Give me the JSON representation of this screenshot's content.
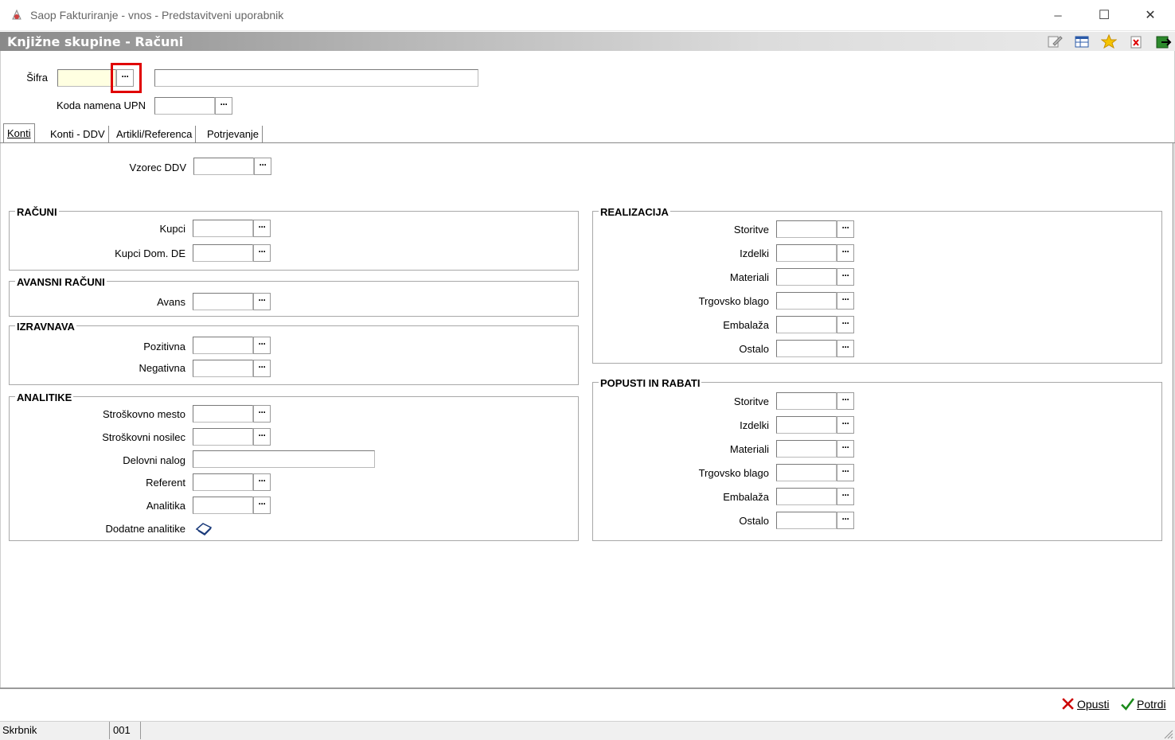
{
  "window": {
    "title": "Saop Fakturiranje - vnos - Predstavitveni uporabnik",
    "minimize_glyph": "─",
    "maximize_glyph": "☐",
    "close_glyph": "✕"
  },
  "header": {
    "title": "Knjižne skupine - Računi",
    "toolbar_icons": [
      "edit-icon",
      "table-icon",
      "star-icon",
      "delete-icon",
      "exit-icon"
    ]
  },
  "top": {
    "sifra_label": "Šifra",
    "sifra_value": "",
    "name_value": "",
    "koda_label": "Koda namena UPN",
    "koda_value": "",
    "dots": "···"
  },
  "tabs": [
    "Konti",
    "Konti - DDV",
    "Artikli/Referenca",
    "Potrjevanje"
  ],
  "vzorec_label": "Vzorec DDV",
  "racuni": {
    "title": "RAČUNI",
    "labels": [
      "Kupci",
      "Kupci Dom. DE"
    ]
  },
  "avansni": {
    "title": "AVANSNI RAČUNI",
    "labels": [
      "Avans"
    ]
  },
  "izravnava": {
    "title": "IZRAVNAVA",
    "labels": [
      "Pozitivna",
      "Negativna"
    ]
  },
  "analitike": {
    "title": "ANALITIKE",
    "labels": [
      "Stroškovno mesto",
      "Stroškovni nosilec",
      "Delovni nalog",
      "Referent",
      "Analitika",
      "Dodatne analitike"
    ]
  },
  "realizacija": {
    "title": "REALIZACIJA",
    "labels": [
      "Storitve",
      "Izdelki",
      "Materiali",
      "Trgovsko blago",
      "Embalaža",
      "Ostalo"
    ]
  },
  "popusti": {
    "title": "POPUSTI IN RABATI",
    "labels": [
      "Storitve",
      "Izdelki",
      "Materiali",
      "Trgovsko blago",
      "Embalaža",
      "Ostalo"
    ]
  },
  "actions": {
    "cancel": "Opusti",
    "confirm": "Potrdi"
  },
  "status": {
    "user": "Skrbnik",
    "code": "001"
  },
  "colors": {
    "highlight": "#e00000",
    "sifra_bg": "#ffffe1",
    "cancel_icon": "#cc0000",
    "confirm_icon": "#1a8a1a"
  }
}
